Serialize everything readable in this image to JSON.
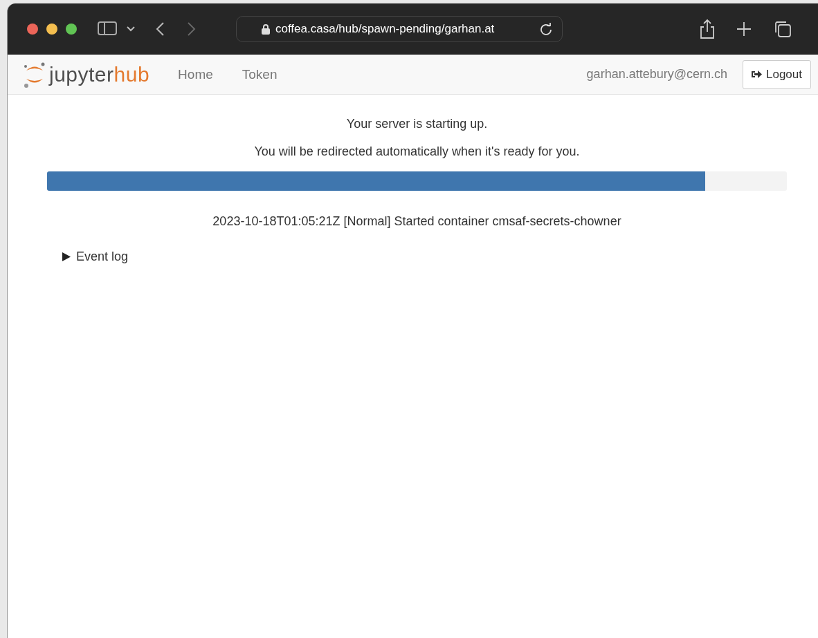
{
  "browser": {
    "url": "coffea.casa/hub/spawn-pending/garhan.at"
  },
  "navbar": {
    "logo": {
      "plain": "jupyter",
      "accent": "hub"
    },
    "links": [
      {
        "label": "Home"
      },
      {
        "label": "Token"
      }
    ],
    "user": "garhan.attebury@cern.ch",
    "logout": "Logout"
  },
  "status": {
    "heading": "Your server is starting up.",
    "message": "You will be redirected automatically when it's ready for you.",
    "progress": {
      "level": 0.89
    },
    "event": "2023-10-18T01:05:21Z [Normal] Started container cmsaf-secrets-chowner"
  },
  "event_log": {
    "label": "Event log",
    "expanded": false
  }
}
